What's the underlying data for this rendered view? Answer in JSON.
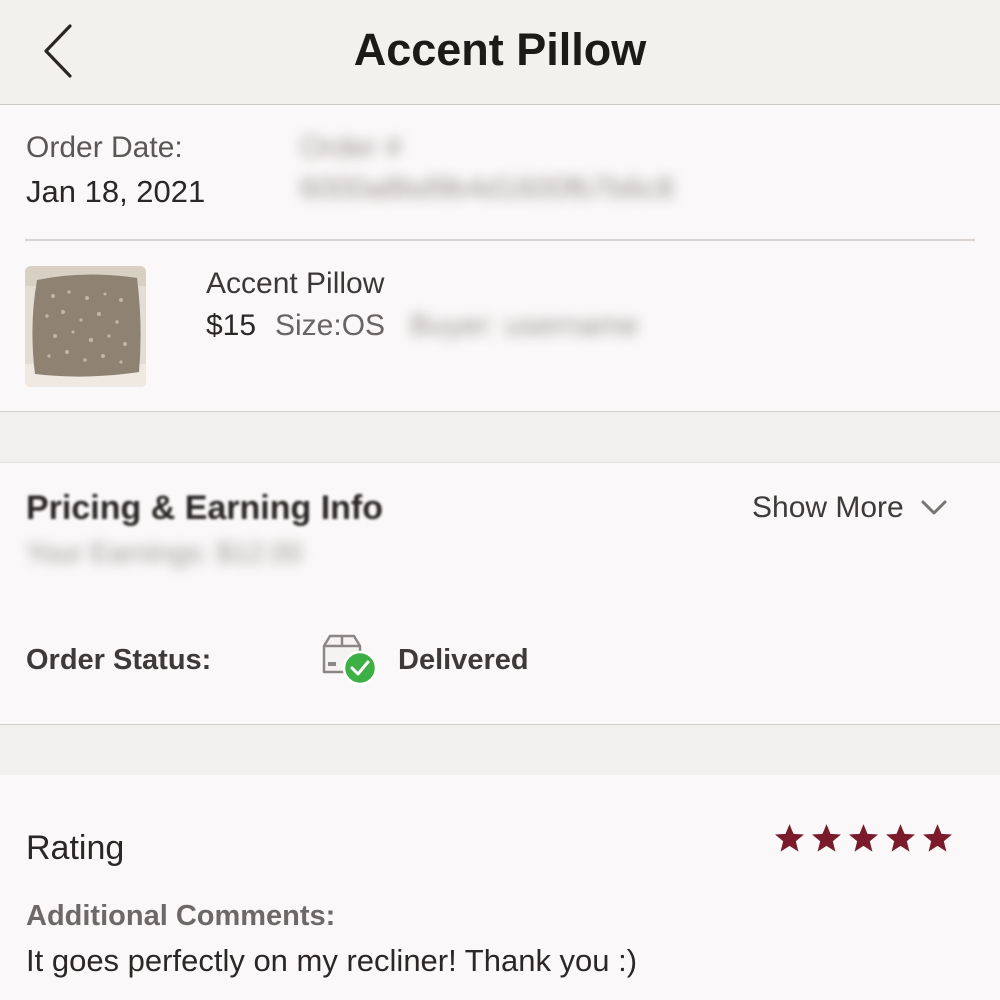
{
  "header": {
    "title": "Accent Pillow"
  },
  "order": {
    "date_label": "Order Date:",
    "date_value": "Jan 18, 2021",
    "number_label": "Order #",
    "number_value": "6000a8bd9b4d1600fb7b6c8"
  },
  "item": {
    "title": "Accent Pillow",
    "price": "$15",
    "size": "Size:OS",
    "extra": "Buyer: username"
  },
  "pricing": {
    "title": "Pricing & Earning Info",
    "subtitle": "Your Earnings: $12.00",
    "show_more": "Show More"
  },
  "status": {
    "label": "Order Status:",
    "value": "Delivered",
    "icon": "package-delivered-icon"
  },
  "review": {
    "rating_label": "Rating",
    "rating": 5,
    "rating_max": 5,
    "comments_label": "Additional Comments:",
    "comments_text": "It goes perfectly on my recliner! Thank you :)"
  },
  "colors": {
    "star": "#7b1a2a",
    "delivered_check": "#3cb043",
    "background": "#f2f0ee",
    "panel": "#faf8f8"
  }
}
